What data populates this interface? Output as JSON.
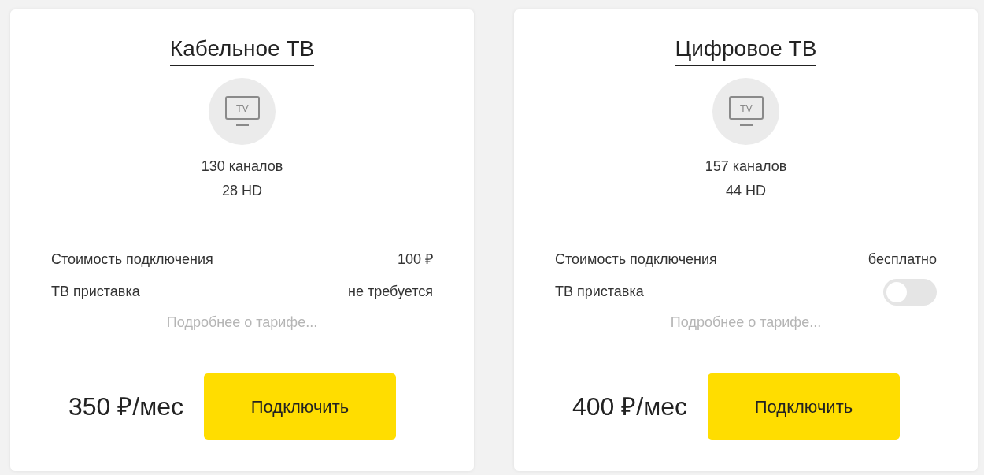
{
  "cards": [
    {
      "title": "Кабельное ТВ",
      "icon_label": "TV",
      "channels": "130 каналов",
      "hd": "28 HD",
      "rows": [
        {
          "kind": "text",
          "label": "Стоимость подключения",
          "value": "100 ₽"
        },
        {
          "kind": "text",
          "label": "ТВ приставка",
          "value": "не требуется"
        }
      ],
      "more_link": "Подробнее о тарифе...",
      "price": "350 ₽/мес",
      "button": "Подключить"
    },
    {
      "title": "Цифровое ТВ",
      "icon_label": "TV",
      "channels": "157 каналов",
      "hd": "44 HD",
      "rows": [
        {
          "kind": "text",
          "label": "Стоимость подключения",
          "value": "бесплатно"
        },
        {
          "kind": "toggle",
          "label": "ТВ приставка",
          "on": false
        }
      ],
      "more_link": "Подробнее о тарифе...",
      "price": "400 ₽/мес",
      "button": "Подключить"
    }
  ]
}
